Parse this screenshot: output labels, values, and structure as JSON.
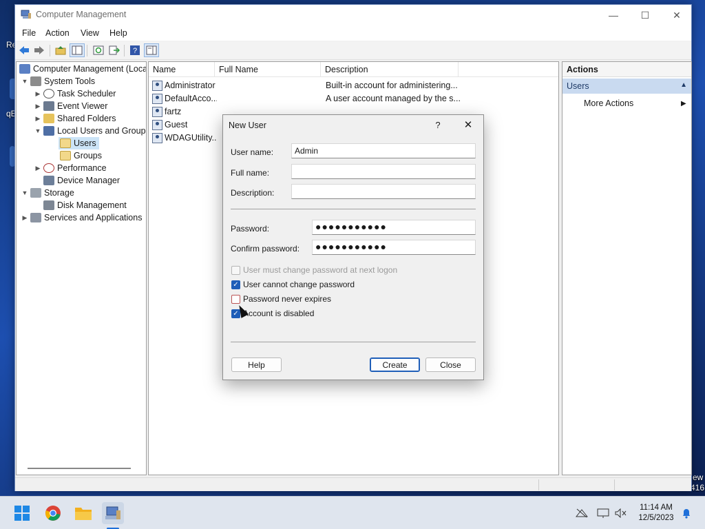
{
  "desktop": {
    "frag_left_1": "Re",
    "frag_left_2": "qE",
    "frag_right_1": "ew",
    "frag_right_2": "416"
  },
  "window": {
    "title": "Computer Management",
    "controls": {
      "minimize": "—",
      "maximize": "☐",
      "close": "✕"
    }
  },
  "menu": {
    "file": "File",
    "action": "Action",
    "view": "View",
    "help": "Help"
  },
  "tree": {
    "root": "Computer Management (Local",
    "system_tools": "System Tools",
    "task_scheduler": "Task Scheduler",
    "event_viewer": "Event Viewer",
    "shared_folders": "Shared Folders",
    "local_users_groups": "Local Users and Groups",
    "users": "Users",
    "groups": "Groups",
    "performance": "Performance",
    "device_manager": "Device Manager",
    "storage": "Storage",
    "disk_management": "Disk Management",
    "services_apps": "Services and Applications"
  },
  "list": {
    "columns": {
      "name": "Name",
      "full_name": "Full Name",
      "description": "Description"
    },
    "rows": [
      {
        "name": "Administrator",
        "full_name": "",
        "description": "Built-in account for administering..."
      },
      {
        "name": "DefaultAcco...",
        "full_name": "",
        "description": "A user account managed by the s..."
      },
      {
        "name": "fartz",
        "full_name": "",
        "description": ""
      },
      {
        "name": "Guest",
        "full_name": "",
        "description": ""
      },
      {
        "name": "WDAGUtility...",
        "full_name": "",
        "description": ""
      }
    ]
  },
  "actions": {
    "title": "Actions",
    "section": "Users",
    "more_actions": "More Actions"
  },
  "dialog": {
    "title": "New User",
    "help_icon": "?",
    "close_icon": "✕",
    "username_label": "User name:",
    "username_value": "Admin",
    "fullname_label": "Full name:",
    "fullname_value": "",
    "description_label": "Description:",
    "description_value": "",
    "password_label": "Password:",
    "password_value": "●●●●●●●●●●●",
    "confirm_label": "Confirm password:",
    "confirm_value": "●●●●●●●●●●●",
    "chk_must_change": "User must change password at next logon",
    "chk_cannot_change": "User cannot change password",
    "chk_never_expires": "Password never expires",
    "chk_disabled": "Account is disabled",
    "checks": {
      "must_change": false,
      "cannot_change": true,
      "never_expires": false,
      "disabled": true
    },
    "help_button": "Help",
    "create_button": "Create",
    "close_button": "Close"
  },
  "taskbar": {
    "time": "11:14 AM",
    "date": "12/5/2023"
  },
  "colors": {
    "accent": "#1f5eb8",
    "selection": "#cce4f7",
    "actions_header": "#c9daf0"
  },
  "icons": [
    "back-icon",
    "forward-icon",
    "up-icon",
    "show-hide-tree-icon",
    "refresh-icon",
    "export-icon",
    "help-icon",
    "console-icon",
    "start-icon",
    "chrome-icon",
    "file-explorer-icon",
    "computer-management-icon",
    "network-icon",
    "display-icon",
    "volume-icon",
    "notification-bell-icon"
  ]
}
